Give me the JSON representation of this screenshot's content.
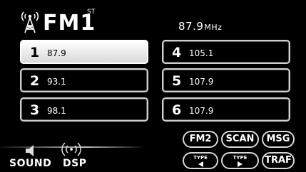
{
  "header": {
    "band": "FM1",
    "stereo": "ST",
    "frequency": "87.9",
    "frequency_unit": "MHz",
    "icon": "radio-tower-icon"
  },
  "presets": [
    {
      "num": "1",
      "freq": "87.9",
      "selected": true
    },
    {
      "num": "2",
      "freq": "93.1",
      "selected": false
    },
    {
      "num": "3",
      "freq": "98.1",
      "selected": false
    },
    {
      "num": "4",
      "freq": "105.1",
      "selected": false
    },
    {
      "num": "5",
      "freq": "107.9",
      "selected": false
    },
    {
      "num": "6",
      "freq": "107.9",
      "selected": false
    }
  ],
  "bottom": {
    "sound_label": "SOUND",
    "sound_icon": "speaker-icon",
    "dsp_label": "DSP",
    "dsp_icon": "dsp-icon"
  },
  "buttons": {
    "fm2": "FM2",
    "scan": "SCAN",
    "msg": "MSG",
    "type_label": "TYPE",
    "traf": "TRAF"
  },
  "colors": {
    "background": "#000000",
    "text": "#ffffff",
    "selected_bg": "#ffffff",
    "border": "#cfcfcf"
  }
}
